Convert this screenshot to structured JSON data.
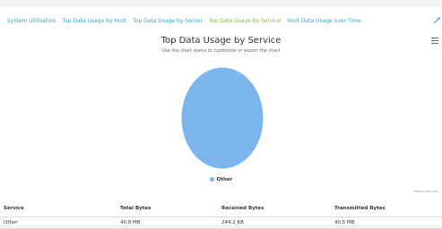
{
  "tabs": [
    {
      "label": "System Utilisation"
    },
    {
      "label": "Top Data Usage by Host"
    },
    {
      "label": "Top Data Usage by Server"
    },
    {
      "label": "Top Data Usage by Service",
      "active": true
    },
    {
      "label": "Host Data Usage over Time"
    }
  ],
  "toolbar": {
    "icon": "wrench-icon"
  },
  "chart": {
    "title": "Top Data Usage by Service",
    "subtitle": "Use the chart menu to customize or export the chart",
    "credits": "Highcharts.com",
    "menu_icon": "hamburger-icon"
  },
  "chart_data": {
    "type": "pie",
    "title": "Top Data Usage by Service",
    "subtitle": "Use the chart menu to customize or export the chart",
    "categories": [
      "Other"
    ],
    "values": [
      100
    ],
    "colors": [
      "#7cb5ec"
    ],
    "legend": {
      "position": "bottom-center",
      "entries": [
        "Other"
      ]
    }
  },
  "table": {
    "headers": [
      "Service",
      "Total Bytes",
      "Received Bytes",
      "Transmitted Bytes"
    ],
    "rows": [
      [
        "Other",
        "40.8 MB",
        "244.2 KB",
        "40.5 MB"
      ]
    ]
  },
  "colors": {
    "tab": "#2ba6cb",
    "tab_active": "#8ab34a",
    "slice": "#7cb5ec"
  }
}
